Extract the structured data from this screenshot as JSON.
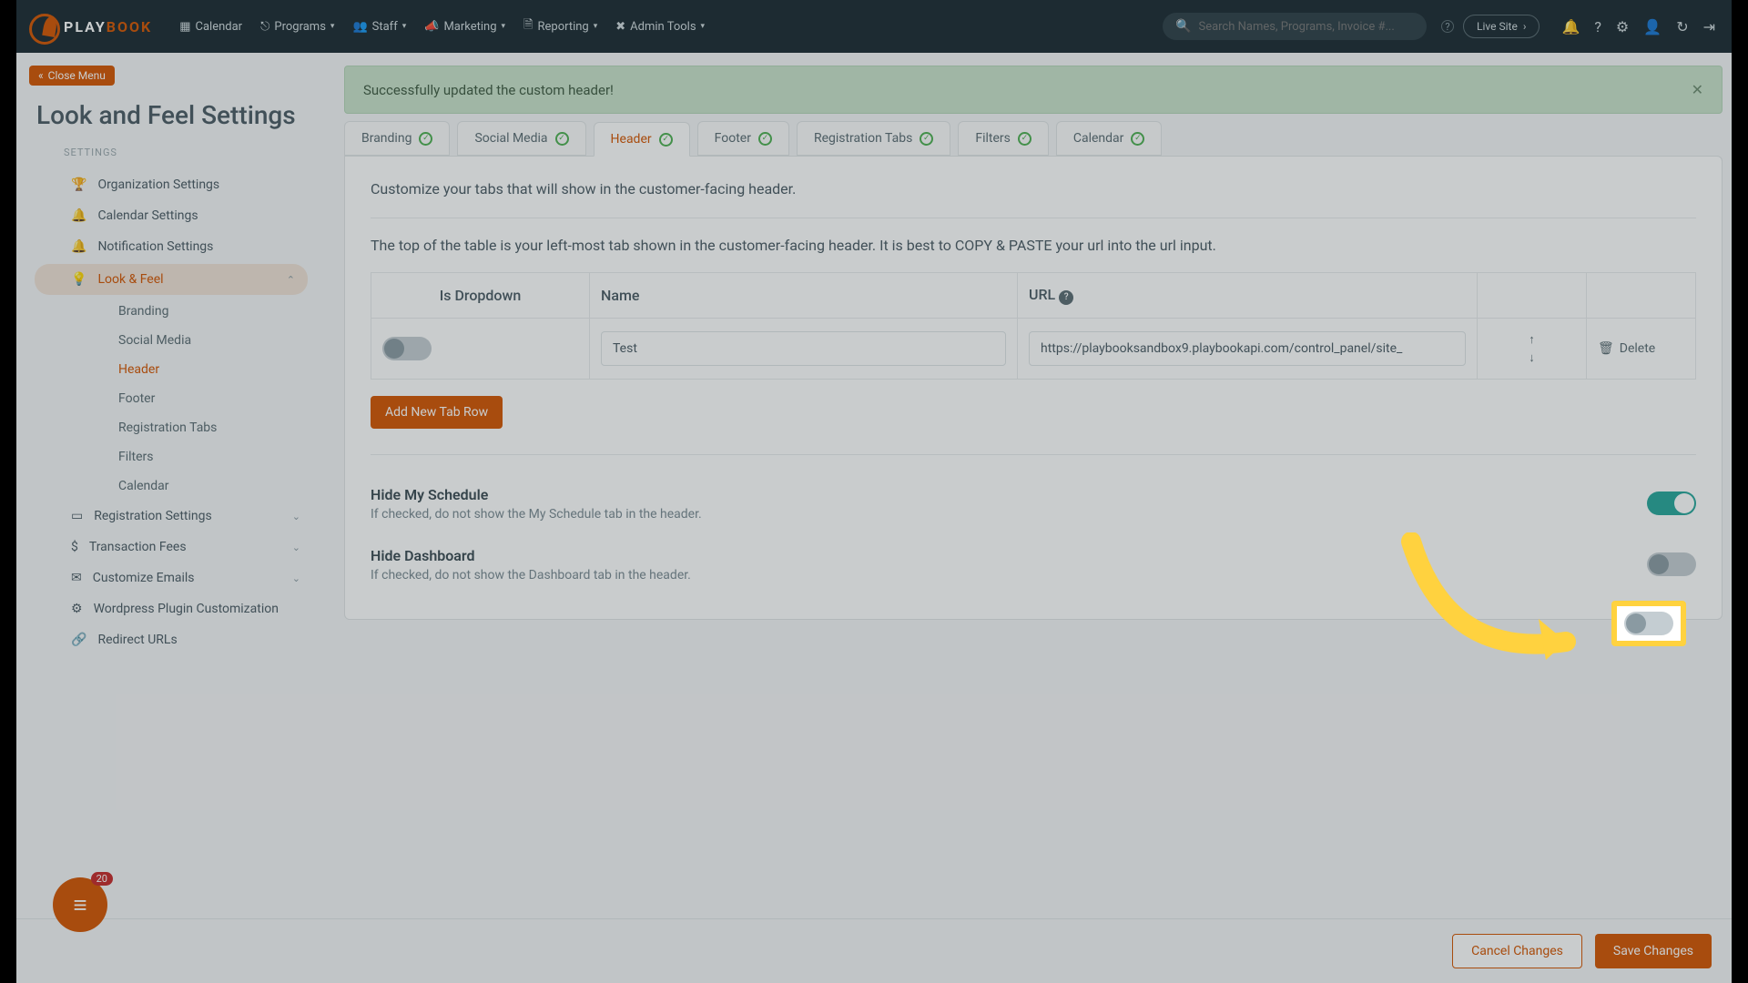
{
  "topbar": {
    "logo_play": "PLAY",
    "logo_book": "BOOK",
    "nav": {
      "calendar": "Calendar",
      "programs": "Programs",
      "staff": "Staff",
      "marketing": "Marketing",
      "reporting": "Reporting",
      "admin": "Admin Tools"
    },
    "search_placeholder": "Search Names, Programs, Invoice #...",
    "live_site": "Live Site"
  },
  "sidebar": {
    "close_menu": "Close Menu",
    "page_title": "Look and Feel Settings",
    "settings_label": "SETTINGS",
    "items": {
      "org": "Organization Settings",
      "calendar": "Calendar Settings",
      "notification": "Notification Settings",
      "look_feel": "Look & Feel",
      "registration": "Registration Settings",
      "transaction": "Transaction Fees",
      "emails": "Customize Emails",
      "wordpress": "Wordpress Plugin Customization",
      "redirect": "Redirect URLs"
    },
    "look_feel_sub": {
      "branding": "Branding",
      "social": "Social Media",
      "header": "Header",
      "footer": "Footer",
      "reg_tabs": "Registration Tabs",
      "filters": "Filters",
      "calendar": "Calendar"
    }
  },
  "main": {
    "alert": "Successfully updated the custom header!",
    "tabs": {
      "branding": "Branding",
      "social": "Social Media",
      "header": "Header",
      "footer": "Footer",
      "reg_tabs": "Registration Tabs",
      "filters": "Filters",
      "calendar": "Calendar"
    },
    "desc1": "Customize your tabs that will show in the customer-facing header.",
    "desc2": "The top of the table is your left-most tab shown in the customer-facing header. It is best to COPY & PASTE your url into the url input.",
    "table": {
      "col_dropdown": "Is Dropdown",
      "col_name": "Name",
      "col_url": "URL",
      "rows": [
        {
          "name": "Test",
          "url": "https://playbooksandbox9.playbookapi.com/control_panel/site_",
          "delete": "Delete"
        }
      ]
    },
    "add_tab": "Add New Tab Row",
    "hide_schedule": {
      "title": "Hide My Schedule",
      "sub": "If checked, do not show the My Schedule tab in the header."
    },
    "hide_dashboard": {
      "title": "Hide Dashboard",
      "sub": "If checked, do not show the Dashboard tab in the header."
    }
  },
  "footer": {
    "cancel": "Cancel Changes",
    "save": "Save Changes"
  },
  "chat_badge": "20"
}
